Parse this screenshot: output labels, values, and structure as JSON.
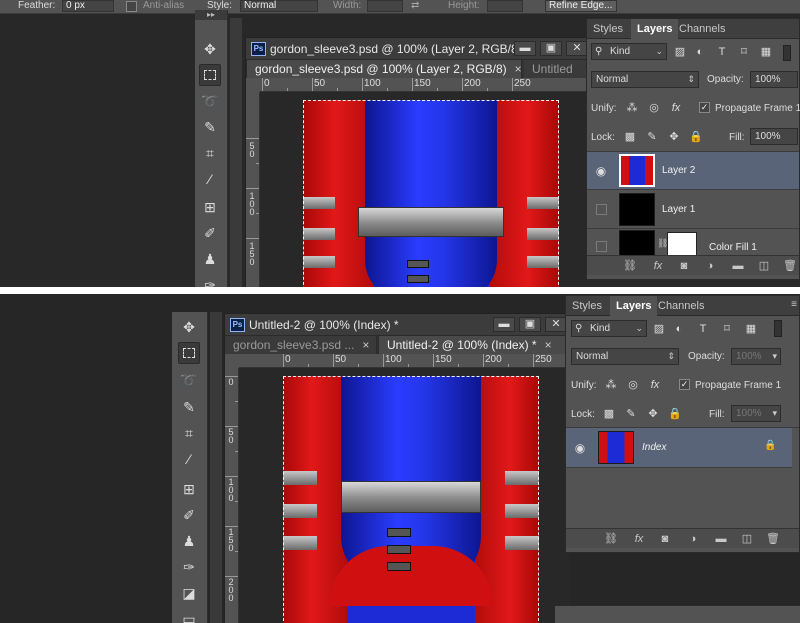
{
  "top": {
    "options_bar": {
      "feather_label": "Feather:",
      "feather_value": "0 px",
      "antialias_label": "Anti-alias",
      "style_label": "Style:",
      "style_value": "Normal",
      "width_label": "Width:",
      "height_label": "Height:",
      "refine_edge_label": "Refine Edge..."
    },
    "toolbar_header": "▸▸",
    "document": {
      "title": "gordon_sleeve3.psd @ 100% (Layer 2, RGB/8...",
      "tabs": [
        {
          "label": "gordon_sleeve3.psd @ 100% (Layer 2, RGB/8)",
          "close": "×"
        },
        {
          "label": "Untitled"
        }
      ],
      "ruler_h": [
        "0",
        "50",
        "100",
        "150",
        "200",
        "250"
      ],
      "ruler_v": [
        "5\n0",
        "1\n0\n0",
        "1\n5\n0"
      ]
    },
    "layers_panel": {
      "tabs": [
        "Styles",
        "Layers",
        "Channels"
      ],
      "active_tab": "Layers",
      "kind_label": "Kind",
      "blend_mode": "Normal",
      "opacity_label": "Opacity:",
      "opacity_value": "100%",
      "unify_label": "Unify:",
      "propagate_label": "Propagate Frame 1",
      "lock_label": "Lock:",
      "fill_label": "Fill:",
      "fill_value": "100%",
      "layers": [
        {
          "name": "Layer 2",
          "visible": true,
          "selected": true
        },
        {
          "name": "Layer 1",
          "visible": false,
          "selected": false
        },
        {
          "name": "Color Fill 1",
          "visible": false,
          "selected": false
        }
      ]
    }
  },
  "bottom": {
    "document": {
      "title": "Untitled-2 @ 100% (Index) *",
      "tabs": [
        {
          "label": "gordon_sleeve3.psd ...",
          "close": "×"
        },
        {
          "label": "Untitled-2 @ 100% (Index) *",
          "close": "×"
        }
      ],
      "ruler_h": [
        "0",
        "50",
        "100",
        "150",
        "200",
        "250"
      ],
      "ruler_v": [
        "0",
        "5\n0",
        "1\n0\n0",
        "1\n5\n0",
        "2\n0\n0"
      ]
    },
    "layers_panel": {
      "tabs": [
        "Styles",
        "Layers",
        "Channels"
      ],
      "active_tab": "Layers",
      "kind_label": "Kind",
      "blend_mode": "Normal",
      "opacity_label": "Opacity:",
      "opacity_value": "100%",
      "unify_label": "Unify:",
      "propagate_label": "Propagate Frame 1",
      "lock_label": "Lock:",
      "fill_label": "Fill:",
      "fill_value": "100%",
      "layers": [
        {
          "name": "Index",
          "visible": true,
          "selected": true,
          "locked": true
        }
      ]
    }
  },
  "colors": {
    "panel_bg": "#535353",
    "selected_layer": "#5a6478",
    "artwork_red": "#d01010",
    "artwork_blue": "#1c2bd6",
    "metal": "#9a9a9a"
  },
  "icons": {
    "eye": "eye-icon",
    "lock": "lock-icon",
    "close": "close-icon"
  }
}
